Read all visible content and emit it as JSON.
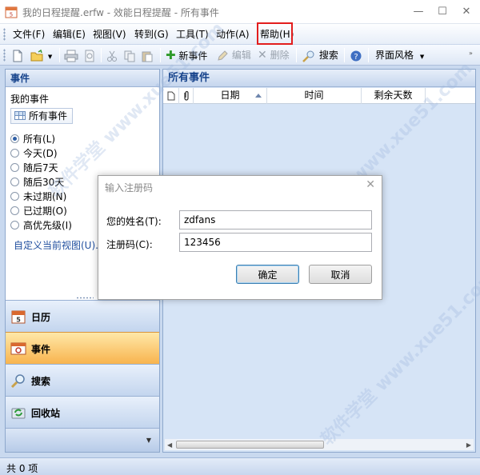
{
  "window": {
    "title": "我的日程提醒.erfw - 效能日程提醒 - 所有事件"
  },
  "menu": [
    "文件(F)",
    "编辑(E)",
    "视图(V)",
    "转到(G)",
    "工具(T)",
    "动作(A)",
    "帮助(H)"
  ],
  "toolbar": {
    "new_event": "新事件",
    "edit": "编辑",
    "delete": "删除",
    "search": "搜索",
    "skin": "界面风格"
  },
  "left_pane": {
    "header": "事件",
    "my_events": "我的事件",
    "all_events": "所有事件",
    "filters": [
      "所有(L)",
      "今天(D)",
      "随后7天",
      "随后30天",
      "未过期(N)",
      "已过期(O)",
      "高优先级(I)"
    ],
    "selected_filter_index": 0,
    "custom_view_link": "自定义当前视图(U)...",
    "nav": [
      {
        "label": "日历",
        "icon": "calendar-icon",
        "active": false
      },
      {
        "label": "事件",
        "icon": "event-list-icon",
        "active": true
      },
      {
        "label": "搜索",
        "icon": "magnifier-icon",
        "active": false
      },
      {
        "label": "回收站",
        "icon": "recycle-bin-icon",
        "active": false
      }
    ]
  },
  "main_pane": {
    "header": "所有事件",
    "columns": [
      "日期",
      "时间",
      "剩余天数"
    ]
  },
  "status": {
    "text": "共 0 项"
  },
  "dialog": {
    "title": "输入注册码",
    "name_label": "您的姓名(T):",
    "name_value": "zdfans",
    "code_label": "注册码(C):",
    "code_value": "123456",
    "ok": "确定",
    "cancel": "取消"
  },
  "watermark": "软件学堂 www.xue51.com",
  "colors": {
    "header_text": "#15428b",
    "active_nav": "#f8b44e",
    "highlight_box": "#e21d1d"
  }
}
